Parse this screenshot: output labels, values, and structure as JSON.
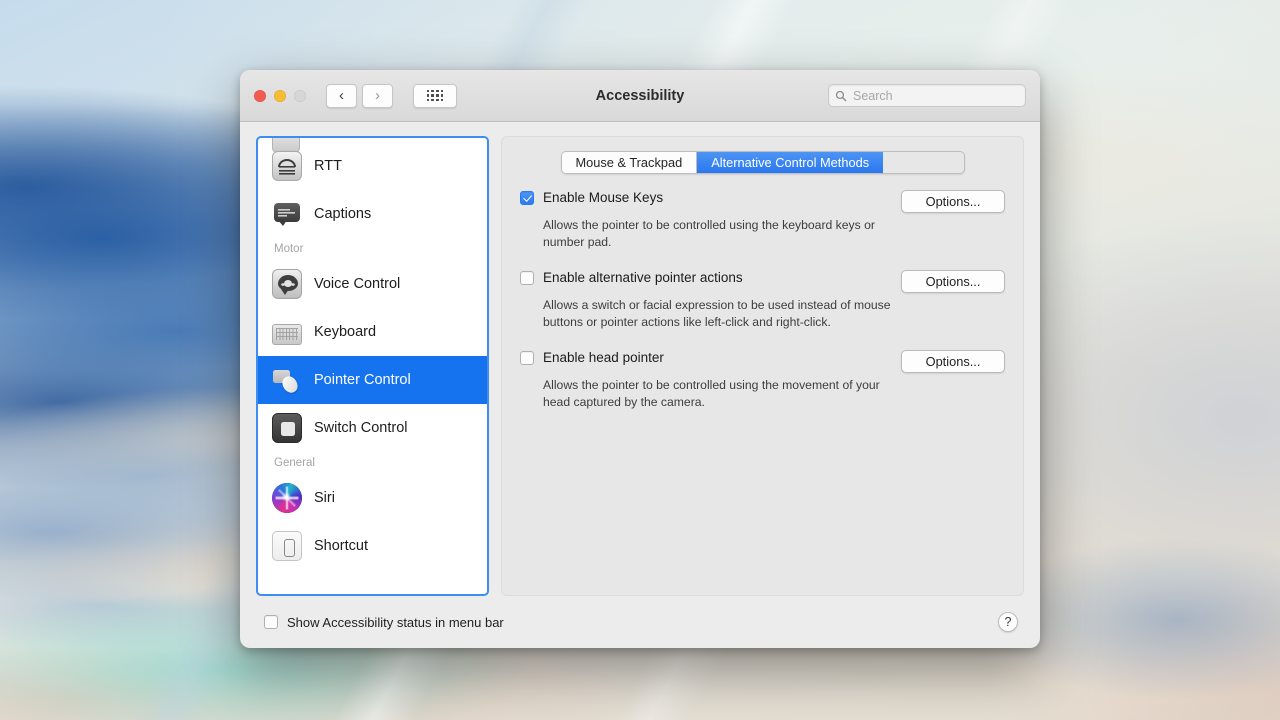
{
  "window": {
    "title": "Accessibility",
    "traffic_lights": [
      "close-button",
      "minimize-button",
      "zoom-button"
    ],
    "nav": {
      "back_glyph": "‹",
      "forward_glyph": "›",
      "grid_label": "show-all-grid"
    },
    "search": {
      "placeholder": "Search",
      "value": "",
      "icon": "search-icon"
    }
  },
  "sidebar": {
    "items": [
      {
        "label": "RTT",
        "icon": "rtt-icon",
        "type": "item",
        "selected": false
      },
      {
        "label": "Captions",
        "icon": "captions-icon",
        "type": "item",
        "selected": false
      },
      {
        "label": "Motor",
        "icon": "",
        "type": "group",
        "selected": false
      },
      {
        "label": "Voice Control",
        "icon": "voice-control-icon",
        "type": "item",
        "selected": false
      },
      {
        "label": "Keyboard",
        "icon": "keyboard-icon",
        "type": "item",
        "selected": false
      },
      {
        "label": "Pointer Control",
        "icon": "pointer-control-icon",
        "type": "item",
        "selected": true
      },
      {
        "label": "Switch Control",
        "icon": "switch-control-icon",
        "type": "item",
        "selected": false
      },
      {
        "label": "General",
        "icon": "",
        "type": "group",
        "selected": false
      },
      {
        "label": "Siri",
        "icon": "siri-icon",
        "type": "item",
        "selected": false
      },
      {
        "label": "Shortcut",
        "icon": "shortcut-icon",
        "type": "item",
        "selected": false
      }
    ]
  },
  "content": {
    "tabs": [
      {
        "label": "Mouse & Trackpad",
        "active": false
      },
      {
        "label": "Alternative Control Methods",
        "active": true
      }
    ],
    "options": [
      {
        "title": "Enable Mouse Keys",
        "checked": true,
        "description": "Allows the pointer to be controlled using the keyboard keys or number pad.",
        "button": "Options..."
      },
      {
        "title": "Enable alternative pointer actions",
        "checked": false,
        "description": "Allows a switch or facial expression to be used instead of mouse buttons or pointer actions like left-click and right-click.",
        "button": "Options..."
      },
      {
        "title": "Enable head pointer",
        "checked": false,
        "description": "Allows the pointer to be controlled using the movement of your head captured by the camera.",
        "button": "Options..."
      }
    ]
  },
  "footer": {
    "show_status_label": "Show Accessibility status in menu bar",
    "show_status_checked": false,
    "help_glyph": "?"
  },
  "colors": {
    "accent_blue": "#1573f0",
    "tab_active_blue": "#2a78ef",
    "sidebar_focus_ring": "#3d8ef0",
    "window_chrome": "#ececec",
    "content_panel": "#e7e7e7"
  }
}
